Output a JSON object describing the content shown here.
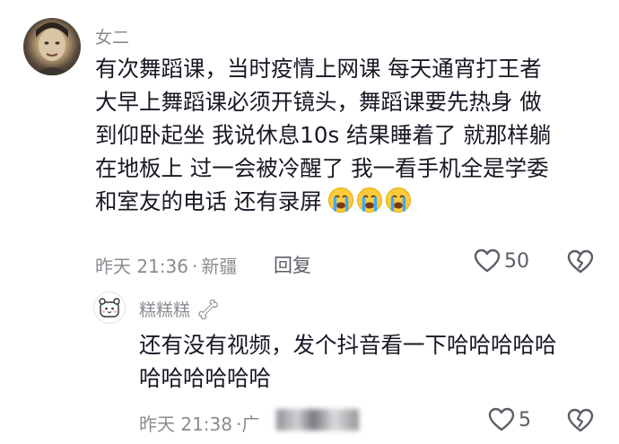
{
  "comment": {
    "username": "女二",
    "lines": [
      "有次舞蹈课，当时疫情上网课 每天通宵打王者",
      "大早上舞蹈课必须开镜头，舞蹈课要先热身 做",
      "到仰卧起坐 我说休息10s 结果睡着了 就那样躺",
      "在地板上 过一会被冷醒了 我一看手机全是学委",
      "和室友的电话 还有录屏"
    ],
    "emoji": "crying-face",
    "time": "昨天 21:36",
    "location": "新疆",
    "separator": "·",
    "reply_label": "回复",
    "like_count": "50"
  },
  "reply": {
    "username": "糕糕糕",
    "lines": [
      "还有没有视频，发个抖音看一下哈哈哈哈哈",
      "哈哈哈哈哈哈"
    ],
    "time": "昨天 21:38",
    "location_partial": "·广",
    "like_count": "5"
  },
  "colors": {
    "text": "#161823",
    "secondary": "#8a8b91",
    "icon": "#5c5e66"
  }
}
